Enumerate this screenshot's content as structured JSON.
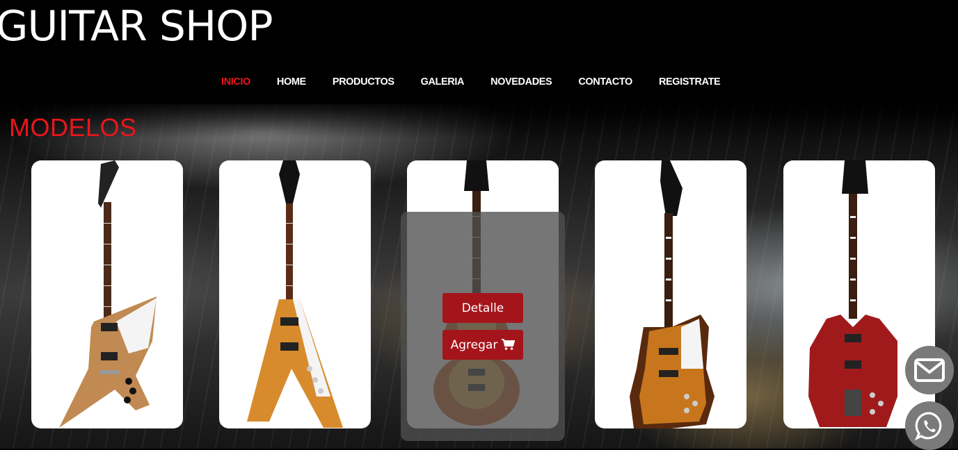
{
  "header": {
    "brand": "GUITAR SHOP"
  },
  "nav": {
    "items": [
      {
        "label": "INICIO",
        "active": true
      },
      {
        "label": "HOME",
        "active": false
      },
      {
        "label": "PRODUCTOS",
        "active": false
      },
      {
        "label": "GALERIA",
        "active": false
      },
      {
        "label": "NOVEDADES",
        "active": false
      },
      {
        "label": "CONTACTO",
        "active": false
      },
      {
        "label": "REGISTRATE",
        "active": false
      }
    ],
    "active_color": "#e8161c",
    "text_color": "#ffffff"
  },
  "section": {
    "title": "MODELOS"
  },
  "products": [
    {
      "icon": "explorer-guitar-natural"
    },
    {
      "icon": "flying-v-guitar-natural"
    },
    {
      "icon": "les-paul-guitar-sunburst"
    },
    {
      "icon": "firebird-guitar-sunburst"
    },
    {
      "icon": "sg-guitar-cherry"
    }
  ],
  "hover_overlay": {
    "detail_label": "Detalle",
    "add_label": "Agregar",
    "add_icon": "cart-icon"
  },
  "floating": {
    "mail_icon": "envelope-icon",
    "whatsapp_icon": "whatsapp-icon"
  },
  "colors": {
    "accent_red": "#e8161c",
    "button_red": "#a4151b"
  }
}
